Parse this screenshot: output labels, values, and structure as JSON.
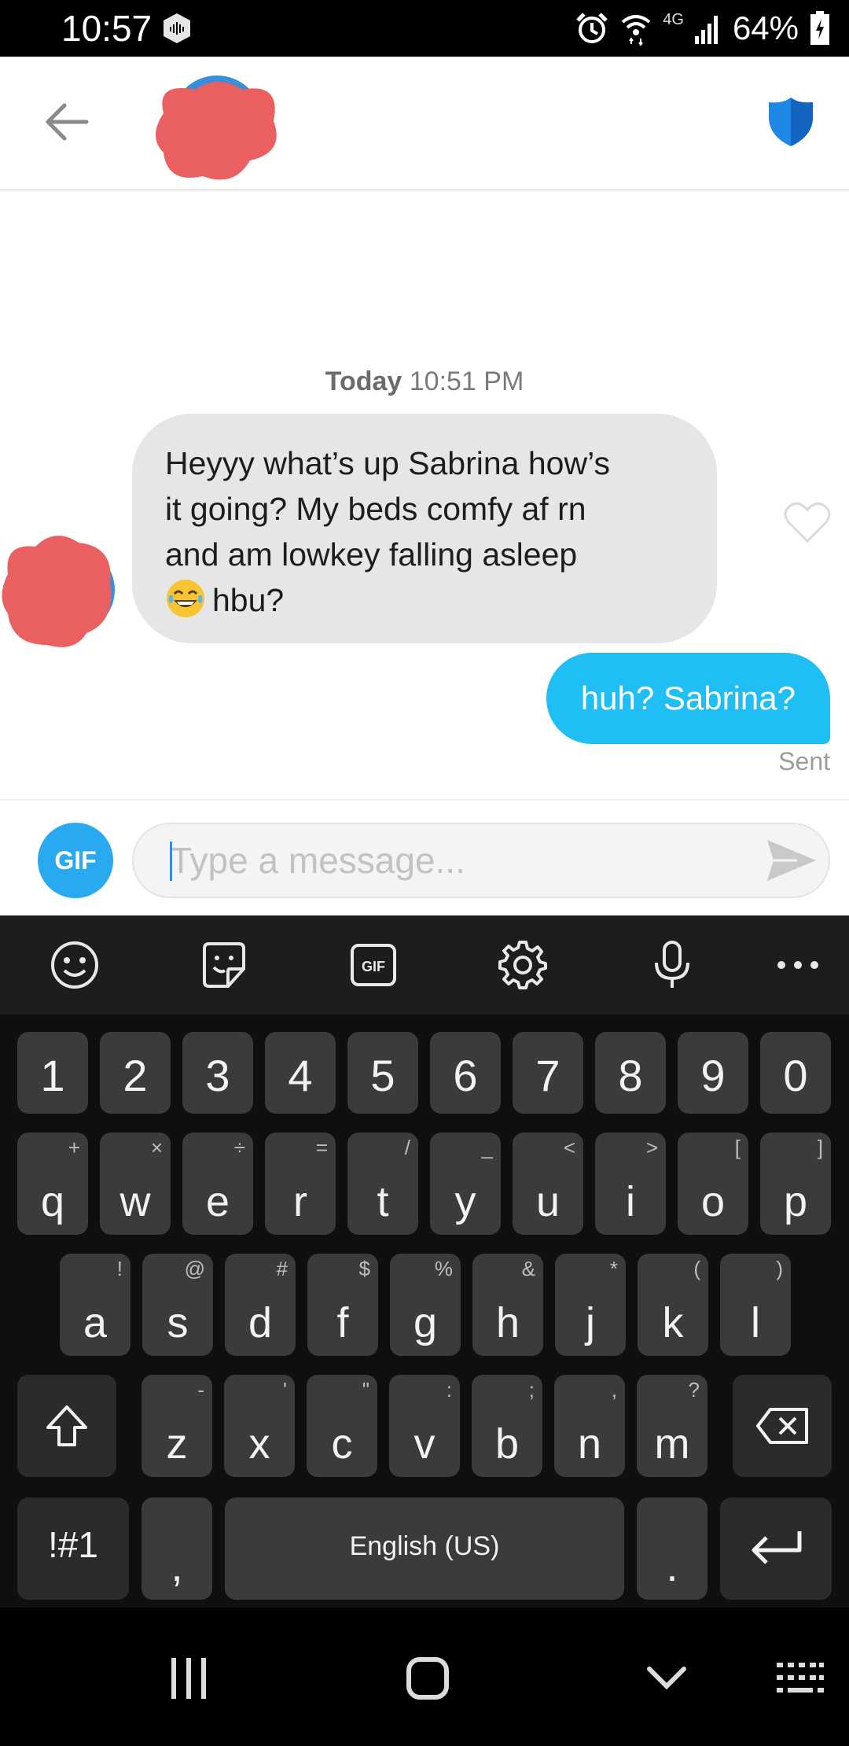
{
  "status_bar": {
    "time": "10:57",
    "network": "4G",
    "battery": "64%"
  },
  "header": {
    "back_icon": "arrow-left-icon",
    "safety_icon": "shield-icon",
    "accent_color": "#1e88e5"
  },
  "chat": {
    "timestamp_day": "Today",
    "timestamp_time": "10:51 PM",
    "received_message": {
      "lines": [
        "Heyyy what’s up Sabrina how’s",
        "it going? My beds comfy af rn",
        "and am lowkey falling asleep"
      ],
      "last_line_text": "hbu?",
      "emoji": "face-with-tears-of-joy"
    },
    "sent_message": "huh? Sabrina?",
    "sent_status": "Sent"
  },
  "composer": {
    "gif_label": "GIF",
    "placeholder": "Type a message...",
    "value": ""
  },
  "keyboard": {
    "toolbar": [
      "emoji-icon",
      "sticker-icon",
      "gif-icon",
      "settings-icon",
      "microphone-icon",
      "more-icon"
    ],
    "gif_toolbar_label": "GIF",
    "number_row": [
      "1",
      "2",
      "3",
      "4",
      "5",
      "6",
      "7",
      "8",
      "9",
      "0"
    ],
    "row1": [
      {
        "k": "q",
        "h": "+"
      },
      {
        "k": "w",
        "h": "×"
      },
      {
        "k": "e",
        "h": "÷"
      },
      {
        "k": "r",
        "h": "="
      },
      {
        "k": "t",
        "h": "/"
      },
      {
        "k": "y",
        "h": "_"
      },
      {
        "k": "u",
        "h": "<"
      },
      {
        "k": "i",
        "h": ">"
      },
      {
        "k": "o",
        "h": "["
      },
      {
        "k": "p",
        "h": "]"
      }
    ],
    "row2": [
      {
        "k": "a",
        "h": "!"
      },
      {
        "k": "s",
        "h": "@"
      },
      {
        "k": "d",
        "h": "#"
      },
      {
        "k": "f",
        "h": "$"
      },
      {
        "k": "g",
        "h": "%"
      },
      {
        "k": "h",
        "h": "&"
      },
      {
        "k": "j",
        "h": "*"
      },
      {
        "k": "k",
        "h": "("
      },
      {
        "k": "l",
        "h": ")"
      }
    ],
    "row3": [
      {
        "k": "z",
        "h": "-"
      },
      {
        "k": "x",
        "h": "'"
      },
      {
        "k": "c",
        "h": "\""
      },
      {
        "k": "v",
        "h": ":"
      },
      {
        "k": "b",
        "h": ";"
      },
      {
        "k": "n",
        "h": ","
      },
      {
        "k": "m",
        "h": "?"
      }
    ],
    "symbols_label": "!#1",
    "comma_label": ",",
    "space_label": "English (US)",
    "period_label": "."
  },
  "nav_bar": {
    "buttons": [
      "recents-icon",
      "home-icon",
      "hide-keyboard-icon",
      "keyboard-switch-icon"
    ]
  }
}
